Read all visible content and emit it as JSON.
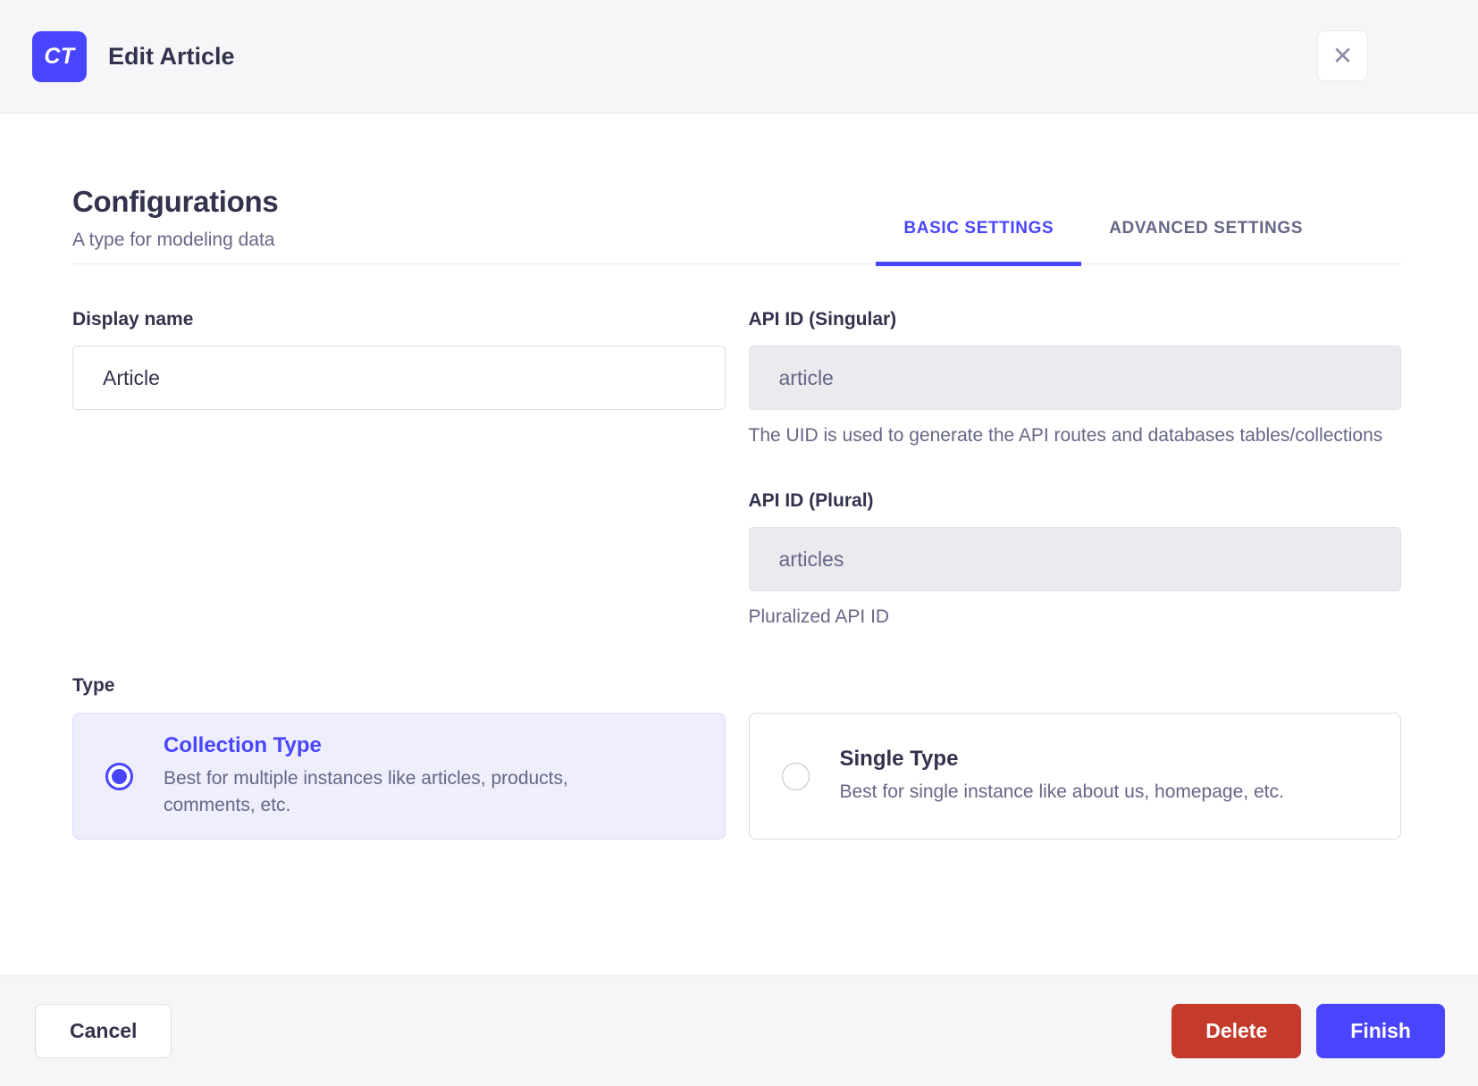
{
  "header": {
    "badge": "CT",
    "title": "Edit Article",
    "close_icon": "✕"
  },
  "section": {
    "title": "Configurations",
    "subtitle": "A type for modeling data",
    "tabs": [
      {
        "label": "BASIC SETTINGS",
        "active": true
      },
      {
        "label": "ADVANCED SETTINGS",
        "active": false
      }
    ]
  },
  "form": {
    "display_name": {
      "label": "Display name",
      "value": "Article"
    },
    "api_id_singular": {
      "label": "API ID (Singular)",
      "value": "article",
      "hint": "The UID is used to generate the API routes and databases tables/collections",
      "disabled": true
    },
    "api_id_plural": {
      "label": "API ID (Plural)",
      "value": "articles",
      "hint": "Pluralized API ID",
      "disabled": true
    },
    "type": {
      "label": "Type",
      "options": [
        {
          "title": "Collection Type",
          "description": "Best for multiple instances like articles, products, comments, etc.",
          "selected": true
        },
        {
          "title": "Single Type",
          "description": "Best for single instance like about us, homepage, etc.",
          "selected": false
        }
      ]
    }
  },
  "footer": {
    "cancel_label": "Cancel",
    "delete_label": "Delete",
    "finish_label": "Finish"
  },
  "colors": {
    "primary": "#4945ff",
    "danger": "#c43a2b",
    "heading_text": "#32324d",
    "muted_text": "#666687",
    "selected_card_bg": "#eeeefc",
    "header_bg": "#f6f6f9",
    "border": "#eaeaef"
  }
}
